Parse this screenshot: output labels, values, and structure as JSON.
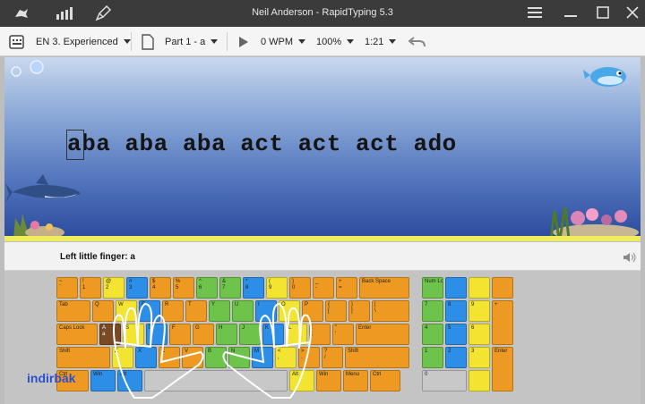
{
  "titlebar": {
    "title": "Neil Anderson - RapidTyping 5.3",
    "icons": [
      "home-icon",
      "stats-icon",
      "broom-icon",
      "menu-icon",
      "minimize-icon",
      "maximize-icon",
      "close-icon"
    ]
  },
  "toolbar": {
    "course": "EN 3. Experienced",
    "lesson": "Part 1 - a",
    "wpm": "0 WPM",
    "accuracy": "100%",
    "time": "1:21"
  },
  "lesson": {
    "text": "aba aba aba act act act ado"
  },
  "hint": {
    "text": "Left little finger: a"
  },
  "keyboard": {
    "row0": [
      "~\n`",
      "!\n1",
      "@\n2",
      "#\n3",
      "$\n4",
      "%\n5",
      "^\n6",
      "&\n7",
      "*\n8",
      "(\n9",
      ")\n0",
      "_\n-",
      "+\n=",
      "Back Space"
    ],
    "row1": [
      "Tab",
      "Q",
      "W",
      "E",
      "R",
      "T",
      "Y",
      "U",
      "I",
      "O",
      "P",
      "{\n[",
      "}\n]",
      "|\n\\"
    ],
    "row2": [
      "Caps Lock",
      "A\na",
      "S",
      "D",
      "F",
      "G",
      "H",
      "J",
      "K",
      "L",
      ":\n;",
      "\"\n'",
      "Enter"
    ],
    "row3": [
      "Shift",
      "Z",
      "X",
      "C",
      "V",
      "B",
      "N",
      "M",
      "<\n,",
      ">\n.",
      "?\n/",
      "Shift"
    ],
    "row4": [
      "Ctrl",
      "Win",
      "Alt",
      "",
      "Alt",
      "Win",
      "Menu",
      "Ctrl"
    ],
    "numpad": {
      "num": "Num Lock",
      "n7": "7",
      "n8": "8",
      "n9": "9",
      "n4": "4",
      "n5": "5",
      "n6": "6",
      "n1": "1",
      "n2": "2",
      "n3": "3",
      "n0": "0",
      "enter": "Enter"
    }
  },
  "watermark": "indirbak"
}
